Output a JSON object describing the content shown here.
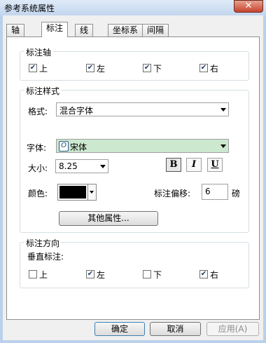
{
  "window": {
    "title": "参考系统属性",
    "close_glyph": "✕"
  },
  "tabs": [
    {
      "label": "轴"
    },
    {
      "label": "标注",
      "active": true
    },
    {
      "label": "线"
    },
    {
      "label": "坐标系"
    },
    {
      "label": "间隔"
    }
  ],
  "axis_group": {
    "legend": "标注轴",
    "options": [
      {
        "label": "上",
        "checked": true
      },
      {
        "label": "左",
        "checked": true
      },
      {
        "label": "下",
        "checked": true
      },
      {
        "label": "右",
        "checked": true
      }
    ]
  },
  "style_group": {
    "legend": "标注样式",
    "format_label": "格式:",
    "format_value": "混合字体",
    "font_label": "字体:",
    "font_value": "宋体",
    "size_label": "大小:",
    "size_value": "8.25",
    "bold_label": "B",
    "italic_label": "I",
    "underline_label": "U",
    "color_label": "颜色:",
    "color_value": "#000000",
    "offset_label": "标注偏移:",
    "offset_value": "6",
    "offset_unit": "磅",
    "more_props_label": "其他属性..."
  },
  "direction_group": {
    "legend": "标注方向",
    "vertical_label": "垂直标注:",
    "options": [
      {
        "label": "上",
        "checked": false
      },
      {
        "label": "左",
        "checked": true
      },
      {
        "label": "下",
        "checked": false
      },
      {
        "label": "右",
        "checked": true
      }
    ]
  },
  "buttons": {
    "ok": "确定",
    "cancel": "取消",
    "apply": "应用(A)"
  },
  "colors": {
    "font_field_bg": "#cce8cf",
    "window_frame": "#b9d1ea"
  }
}
